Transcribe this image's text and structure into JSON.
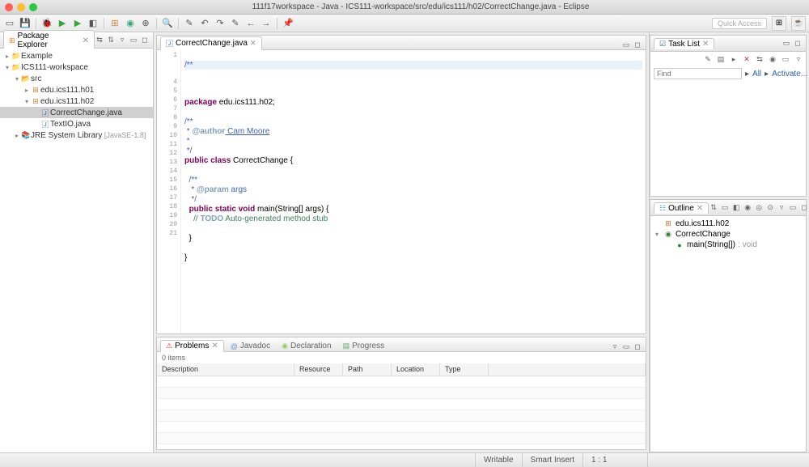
{
  "window": {
    "title": "111f17workspace - Java - ICS111-workspace/src/edu/ics111/h02/CorrectChange.java - Eclipse"
  },
  "toolbar": {
    "quick_access": "Quick Access"
  },
  "package_explorer": {
    "title": "Package Explorer",
    "items": {
      "example": "Example",
      "workspace": "ICS111-workspace",
      "src": "src",
      "pkg_h01": "edu.ics111.h01",
      "pkg_h02": "edu.ics111.h02",
      "file_cc": "CorrectChange.java",
      "file_tio": "TextIO.java",
      "jre": "JRE System Library",
      "jre_dec": "[JavaSE-1.8]"
    }
  },
  "editor": {
    "tab_label": "CorrectChange.java",
    "lines": {
      "l1a": "/**",
      "l1b": "",
      "l4": " edu.ics111.h02;",
      "l6": "/**",
      "l7a": " * ",
      "l7b": "@author",
      "l7c": " Cam Moore",
      "l8": " *",
      "l9": " */",
      "l10a": " ",
      "l10b": "class",
      "l10c": " CorrectChange {",
      "l12": "  /**",
      "l13a": "   * ",
      "l13b": "@param",
      "l13c": " args",
      "l14": "   */",
      "l15a": "  ",
      "l15b": " ",
      "l15c": "static",
      "l15d": " ",
      "l15e": "void",
      "l15f": " main(String[] args) {",
      "l16a": "    // ",
      "l16b": "TODO",
      "l16c": " Auto-generated method stub",
      "l18": "  }",
      "l20": "}",
      "kw_package": "package",
      "kw_public": "public"
    },
    "gutter": [
      "1",
      "",
      "",
      "4",
      "5",
      "6",
      "7",
      "8",
      "9",
      "10",
      "11",
      "12",
      "13",
      "14",
      "15",
      "16",
      "17",
      "18",
      "19",
      "20",
      "21"
    ]
  },
  "task_list": {
    "title": "Task List",
    "find_placeholder": "Find",
    "all": "All",
    "activate": "Activate..."
  },
  "outline": {
    "title": "Outline",
    "pkg": "edu.ics111.h02",
    "cls": "CorrectChange",
    "mth": "main(String[])",
    "ret": " : void"
  },
  "problems": {
    "tab_problems": "Problems",
    "tab_javadoc": "Javadoc",
    "tab_decl": "Declaration",
    "tab_progress": "Progress",
    "count": "0 items",
    "cols": {
      "desc": "Description",
      "res": "Resource",
      "path": "Path",
      "loc": "Location",
      "type": "Type"
    }
  },
  "status": {
    "writable": "Writable",
    "insert": "Smart Insert",
    "pos": "1 : 1"
  }
}
